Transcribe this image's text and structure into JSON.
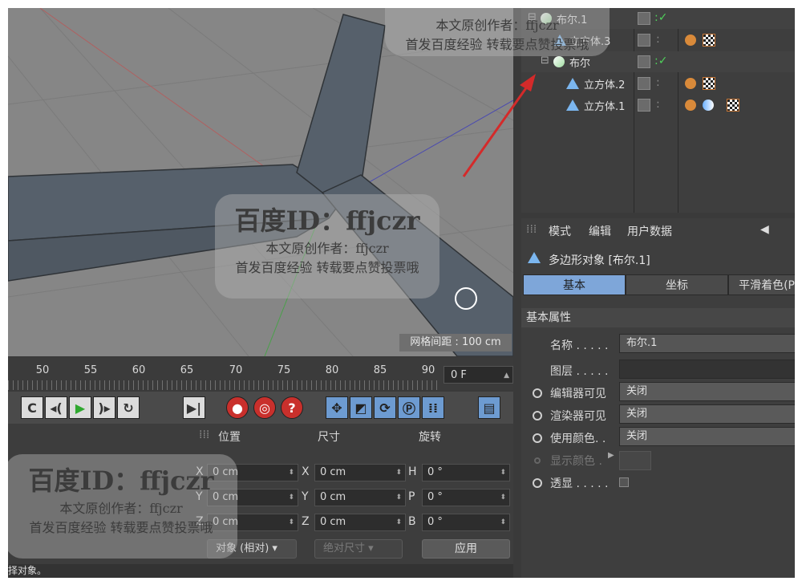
{
  "viewport": {
    "grid_spacing": "网格间距 : 100 cm"
  },
  "timeline": {
    "ticks": [
      "50",
      "55",
      "60",
      "65",
      "70",
      "75",
      "80",
      "85",
      "90"
    ],
    "current_frame": "0 F"
  },
  "coordinates": {
    "headers": {
      "position": "位置",
      "size": "尺寸",
      "rotation": "旋转"
    },
    "rows": [
      {
        "pos_axis": "X",
        "pos": "0 cm",
        "size_axis": "X",
        "size": "0 cm",
        "rot_axis": "H",
        "rot": "0 °"
      },
      {
        "pos_axis": "Y",
        "pos": "0 cm",
        "size_axis": "Y",
        "size": "0 cm",
        "rot_axis": "P",
        "rot": "0 °"
      },
      {
        "pos_axis": "Z",
        "pos": "0 cm",
        "size_axis": "Z",
        "size": "0 cm",
        "rot_axis": "B",
        "rot": "0 °"
      }
    ],
    "mode_dropdown": "对象 (相对)",
    "size_dropdown": "绝对尺寸",
    "apply_button": "应用"
  },
  "status_bar": "择对象。",
  "object_manager": {
    "items": [
      {
        "name": "布尔.1",
        "level": 0
      },
      {
        "name": "立方体.3",
        "level": 1
      },
      {
        "name": "布尔",
        "level": 1
      },
      {
        "name": "立方体.2",
        "level": 2
      },
      {
        "name": "立方体.1",
        "level": 2
      }
    ]
  },
  "attribute_manager": {
    "menu": [
      "模式",
      "编辑",
      "用户数据"
    ],
    "object_title": "多边形对象 [布尔.1]",
    "tabs": [
      "基本",
      "坐标",
      "平滑着色(Pl"
    ],
    "section_title": "基本属性",
    "fields": {
      "name_label": "名称 . . . . .",
      "name_value": "布尔.1",
      "layer_label": "图层 . . . . .",
      "editor_visible_label": "编辑器可见",
      "editor_visible_value": "关闭",
      "render_visible_label": "渲染器可见",
      "render_visible_value": "关闭",
      "use_color_label": "使用颜色. .",
      "use_color_value": "关闭",
      "display_color_label": "显示颜色 .",
      "xray_label": "透显 . . . . ."
    }
  },
  "watermarks": {
    "big": "百度ID：ffjczr",
    "author": "本文原创作者：ffjczr",
    "slogan": "首发百度经验 转载要点赞投票哦"
  },
  "colors": {
    "viewport_bg": "#868686",
    "beam": "#56606b",
    "arrow": "#d42a2a",
    "tab_active": "#7ea6d9"
  }
}
